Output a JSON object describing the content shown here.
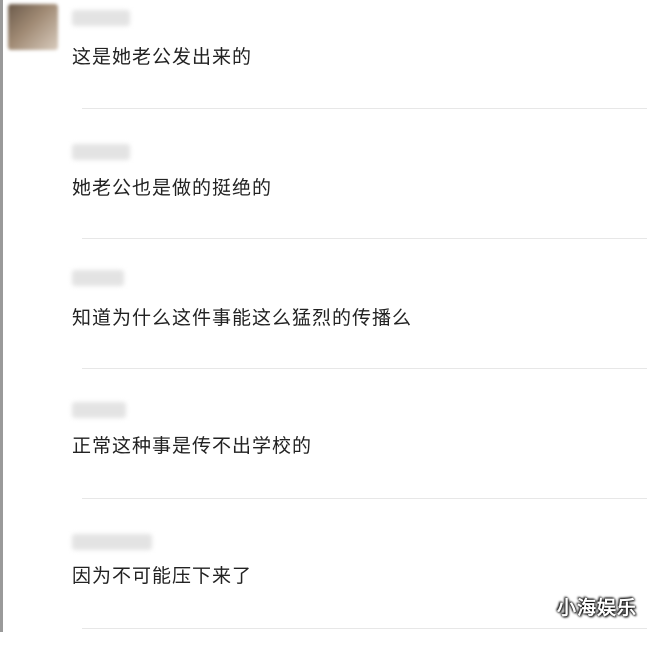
{
  "comments": [
    {
      "text": "这是她老公发出来的"
    },
    {
      "text": "她老公也是做的挺绝的"
    },
    {
      "text": "知道为什么这件事能这么猛烈的传播么"
    },
    {
      "text": "正常这种事是传不出学校的"
    },
    {
      "text": "因为不可能压下来了"
    }
  ],
  "watermark": "小海娱乐"
}
